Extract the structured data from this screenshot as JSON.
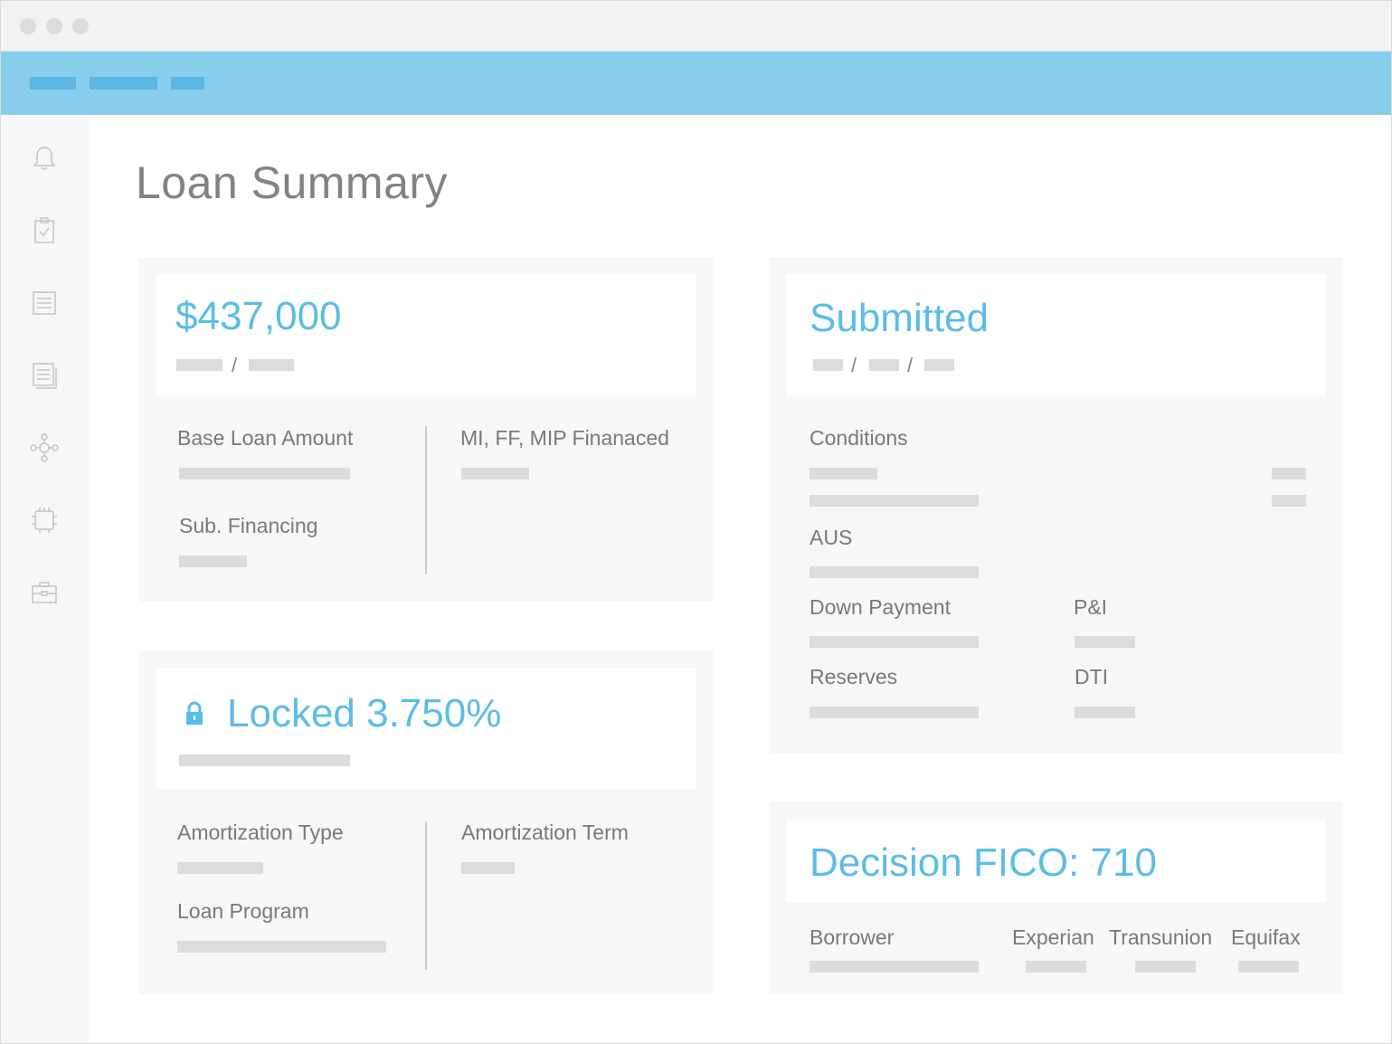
{
  "window": {
    "controls": [
      "close",
      "minimize",
      "maximize"
    ]
  },
  "sidebar": {
    "icons": [
      "bell-icon",
      "clipboard-check-icon",
      "list-icon",
      "document-stack-icon",
      "network-icon",
      "chip-icon",
      "briefcase-icon"
    ]
  },
  "page": {
    "title": "Loan Summary"
  },
  "loan_amount_card": {
    "value": "$437,000",
    "slash": "/",
    "base_loan_amount_label": "Base Loan Amount",
    "mi_ff_mip_label": "MI, FF, MIP Finanaced",
    "sub_financing_label": "Sub. Financing"
  },
  "rate_card": {
    "value": "Locked 3.750%",
    "amortization_type_label": "Amortization Type",
    "amortization_term_label": "Amortization Term",
    "loan_program_label": "Loan Program"
  },
  "status_card": {
    "value": "Submitted",
    "slash": "/",
    "conditions_label": "Conditions",
    "aus_label": "AUS",
    "down_payment_label": "Down Payment",
    "pi_label": "P&I",
    "reserves_label": "Reserves",
    "dti_label": "DTI"
  },
  "fico_card": {
    "value": "Decision FICO: 710",
    "borrower_label": "Borrower",
    "experian_label": "Experian",
    "transunion_label": "Transunion",
    "equifax_label": "Equifax"
  },
  "colors": {
    "accent": "#5bbde6",
    "topnav": "#88ceec",
    "card_bg": "#f7f7f7",
    "placeholder": "#dcdcdc"
  }
}
